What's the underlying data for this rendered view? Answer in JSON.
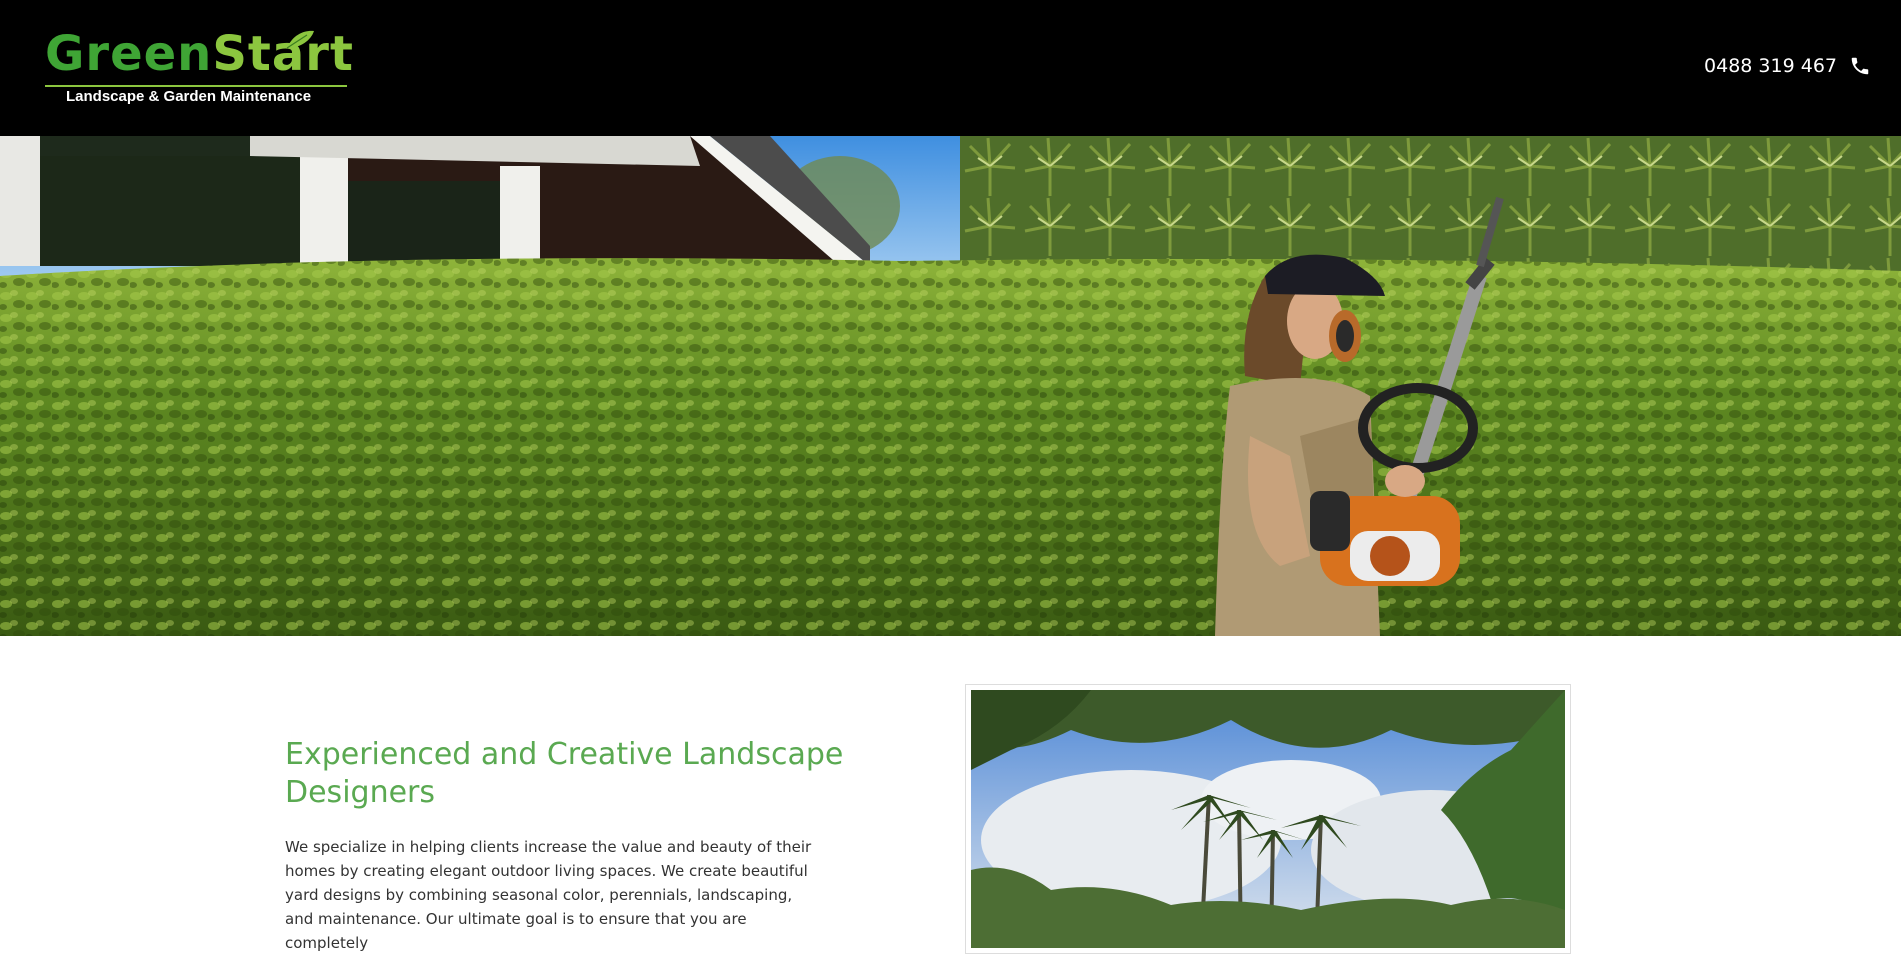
{
  "header": {
    "logo": {
      "word_part1": "Green",
      "word_part2": "Start",
      "tagline": "Landscape & Garden Maintenance"
    },
    "phone": {
      "number": "0488 319 467",
      "icon": "phone-icon"
    }
  },
  "hero": {
    "image": "gardener-trimming-hedge-photo"
  },
  "about": {
    "heading": "Experienced and Creative Landscape Designers",
    "body": "We specialize in helping clients increase the value and beauty of their homes by creating elegant outdoor living spaces. We create beautiful yard designs by combining seasonal color, perennials, landscaping, and maintenance. Our ultimate goal is to ensure that you are completely",
    "image": "palm-trees-garden-photo"
  },
  "colors": {
    "header_bg": "#000000",
    "brand_green": "#3fa535",
    "brand_light_green": "#8cc63f",
    "heading_green": "#5aa951",
    "body_text": "#333333"
  }
}
